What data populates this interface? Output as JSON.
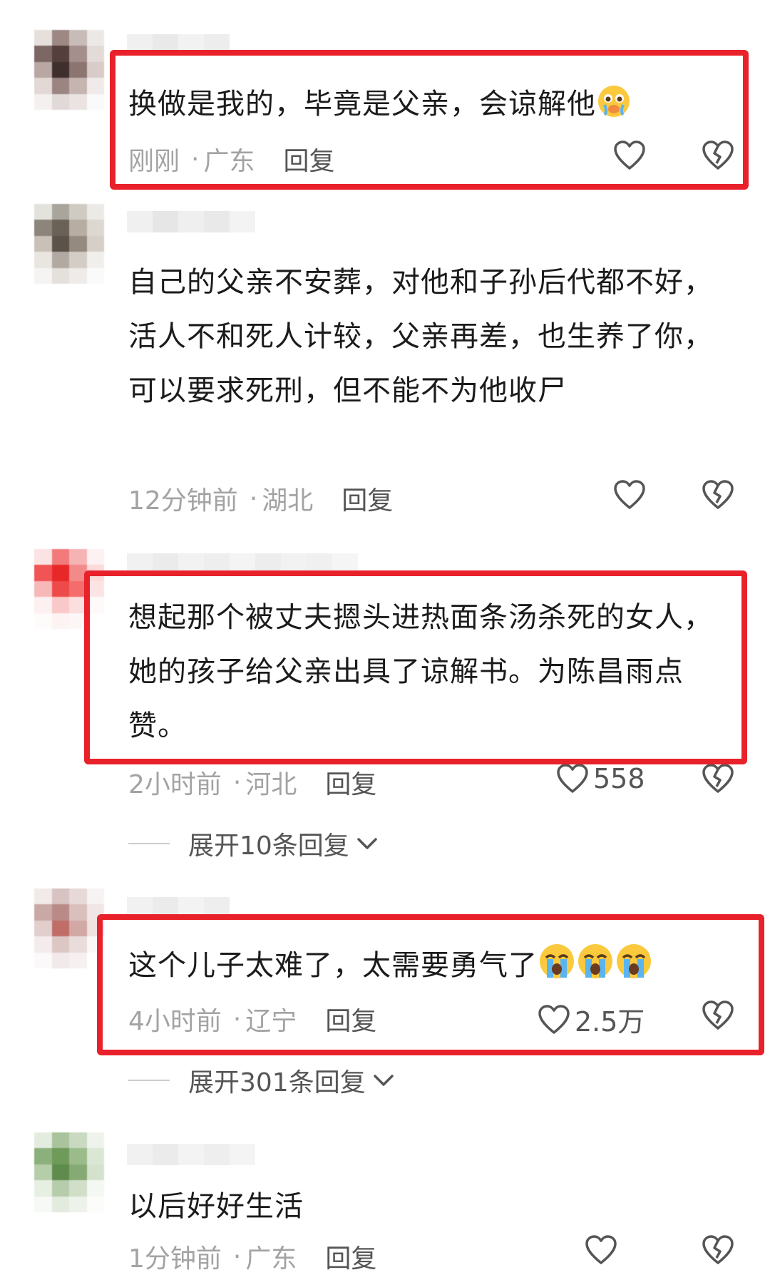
{
  "colors": {
    "highlight": "#e8212a",
    "text": "#1b1b1b",
    "meta": "#a3a3a3",
    "reply": "#555555"
  },
  "comments": [
    {
      "text": "换做是我的，毕竟是父亲，会谅解他",
      "emojis": [
        "crying-pleading-emoji"
      ],
      "time": "刚刚",
      "location": "广东",
      "reply": "回复",
      "likes": ""
    },
    {
      "text": "自己的父亲不安葬，对他和子孙后代都不好，活人不和死人计较，父亲再差，也生养了你，可以要求死刑，但不能不为他收尸",
      "emojis": [],
      "time": "12分钟前",
      "location": "湖北",
      "reply": "回复",
      "likes": ""
    },
    {
      "text": "想起那个被丈夫摁头进热面条汤杀死的女人，她的孩子给父亲出具了谅解书。为陈昌雨点赞。",
      "emojis": [],
      "time": "2小时前",
      "location": "河北",
      "reply": "回复",
      "likes": "558",
      "expand": "展开10条回复"
    },
    {
      "text": "这个儿子太难了，太需要勇气了",
      "emojis": [
        "loudly-crying-emoji",
        "loudly-crying-emoji",
        "loudly-crying-emoji"
      ],
      "time": "4小时前",
      "location": "辽宁",
      "reply": "回复",
      "likes": "2.5万",
      "expand": "展开301条回复"
    },
    {
      "text": "以后好好生活",
      "emojis": [],
      "time": "1分钟前",
      "location": "广东",
      "reply": "回复",
      "likes": ""
    }
  ]
}
